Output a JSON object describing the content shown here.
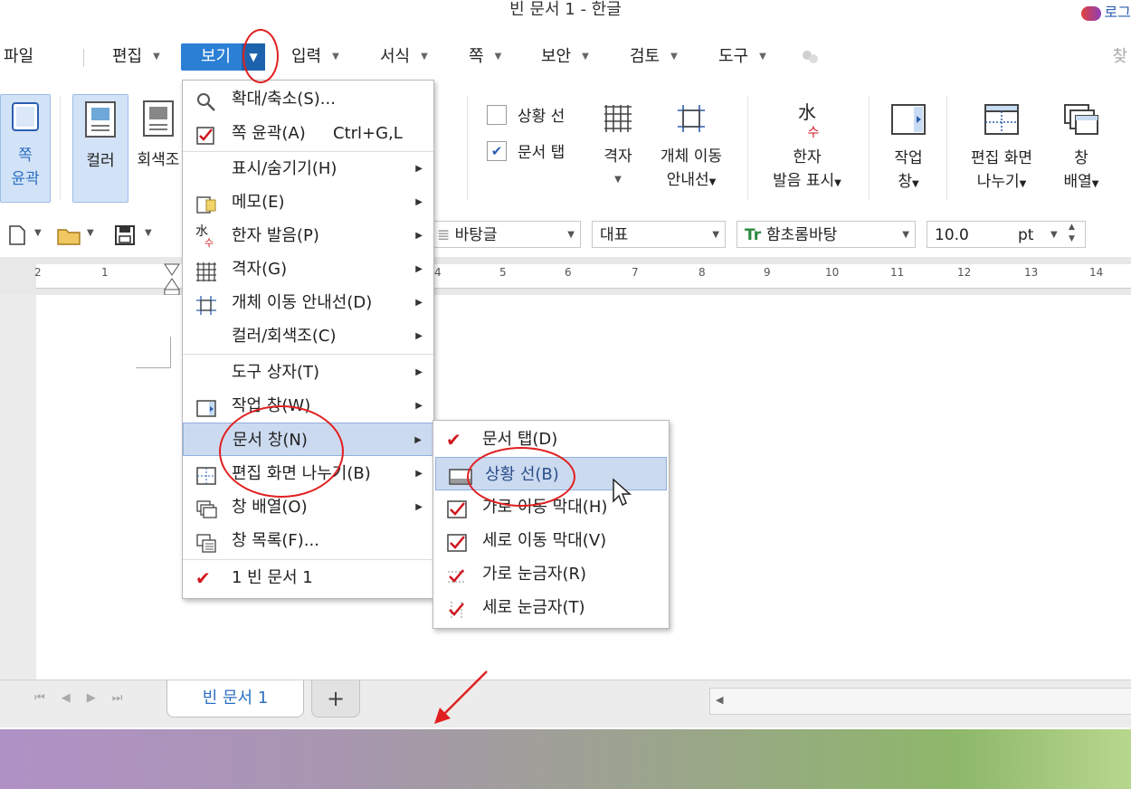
{
  "title": "빈 문서 1 - 한글",
  "login": "로그",
  "menubar": {
    "file": "파일",
    "edit": "편집",
    "view": "보기",
    "input": "입력",
    "format": "서식",
    "page": "쪽",
    "security": "보안",
    "review": "검토",
    "tools": "도구",
    "search_hint": "찾"
  },
  "ribbon": {
    "outline_top": "쪽",
    "outline_bottom": "윤곽",
    "color": "컬러",
    "grayscale": "회색조",
    "status_line": "상황 선",
    "doc_tab": "문서 탭",
    "grid": "격자",
    "object_guide_1": "개체 이동",
    "object_guide_2": "안내선",
    "hanja_1": "한자",
    "hanja_2": "발음 표시",
    "task_1": "작업",
    "task_2": "창",
    "split_1": "편집 화면",
    "split_2": "나누기",
    "arrange_1": "창",
    "arrange_2": "배열"
  },
  "toolbar": {
    "style": "바탕글",
    "lang": "대표",
    "font": "함초롬바탕",
    "size": "10.0",
    "unit": "pt"
  },
  "ruler": {
    "ticks": [
      "2",
      "1",
      "4",
      "5",
      "6",
      "7",
      "8",
      "9",
      "10",
      "11",
      "12",
      "13",
      "14"
    ]
  },
  "view_menu": {
    "items": [
      {
        "label": "확대/축소(S)...",
        "shortcut": ""
      },
      {
        "label": "쪽 윤곽(A)",
        "shortcut": "Ctrl+G,L"
      },
      {
        "label": "표시/숨기기(H)"
      },
      {
        "label": "메모(E)"
      },
      {
        "label": "한자 발음(P)"
      },
      {
        "label": "격자(G)"
      },
      {
        "label": "개체 이동 안내선(D)"
      },
      {
        "label": "컬러/회색조(C)"
      },
      {
        "label": "도구 상자(T)"
      },
      {
        "label": "작업 창(W)"
      },
      {
        "label": "문서 창(N)"
      },
      {
        "label": "편집 화면 나누기(B)"
      },
      {
        "label": "창 배열(O)"
      },
      {
        "label": "창 목록(F)..."
      },
      {
        "label": "1 빈 문서 1"
      }
    ]
  },
  "doc_window_menu": {
    "items": [
      {
        "label": "문서 탭(D)"
      },
      {
        "label": "상황 선(B)"
      },
      {
        "label": "가로 이동 막대(H)"
      },
      {
        "label": "세로 이동 막대(V)"
      },
      {
        "label": "가로 눈금자(R)"
      },
      {
        "label": "세로 눈금자(T)"
      }
    ]
  },
  "tabs": {
    "doc_tab": "빈 문서 1",
    "add": "+"
  },
  "colors": {
    "accent": "#2b7fd4",
    "annotation_red": "#e02020",
    "highlight": "#ccdaf0"
  }
}
